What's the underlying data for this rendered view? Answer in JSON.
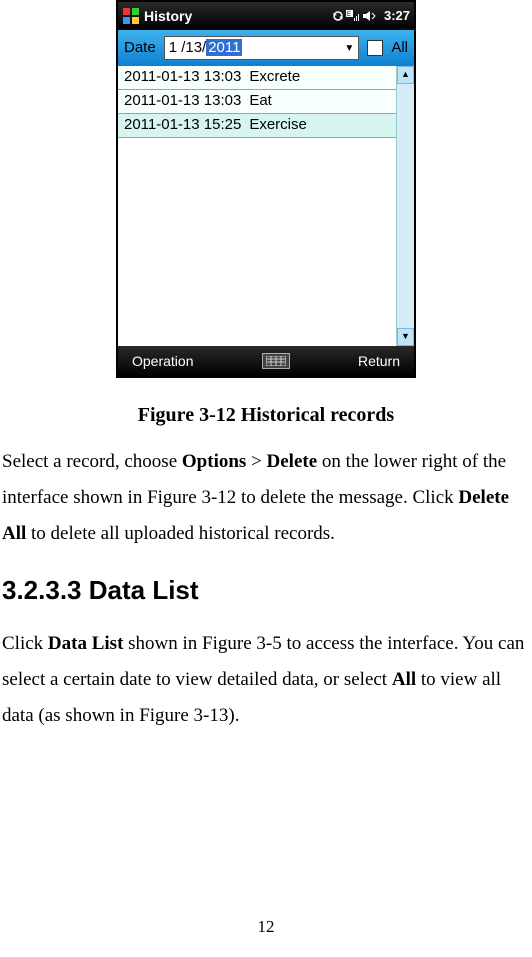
{
  "device": {
    "titlebar": {
      "title": "History",
      "clock": "3:27"
    },
    "datebar": {
      "label": "Date",
      "value_prefix": "1 /13/",
      "value_selected": "2011",
      "all_label": "All"
    },
    "rows": [
      {
        "ts": "2011-01-13 13:03",
        "act": "Excrete",
        "selected": false
      },
      {
        "ts": "2011-01-13 13:03",
        "act": "Eat",
        "selected": false
      },
      {
        "ts": "2011-01-13 15:25",
        "act": "Exercise",
        "selected": true
      }
    ],
    "bottombar": {
      "left": "Operation",
      "right": "Return"
    }
  },
  "caption": "Figure 3-12 Historical records",
  "para1_a": "Select a record, choose ",
  "para1_options": "Options",
  "para1_gt": " > ",
  "para1_delete": "Delete",
  "para1_b": " on the lower right of the interface shown in Figure 3-12 to delete the message. Click ",
  "para1_deleteall": "Delete All",
  "para1_c": " to delete all uploaded historical records.",
  "heading_num": "3.2.3",
  "heading_rest": ".3 Data List",
  "para2_a": "Click ",
  "para2_datalist": "Data List",
  "para2_b": " shown in Figure 3-5 to access the interface. You can select a certain date to view detailed data, or select ",
  "para2_all": "All",
  "para2_c": " to view all data (as shown in Figure 3-13).",
  "page_number": "12"
}
